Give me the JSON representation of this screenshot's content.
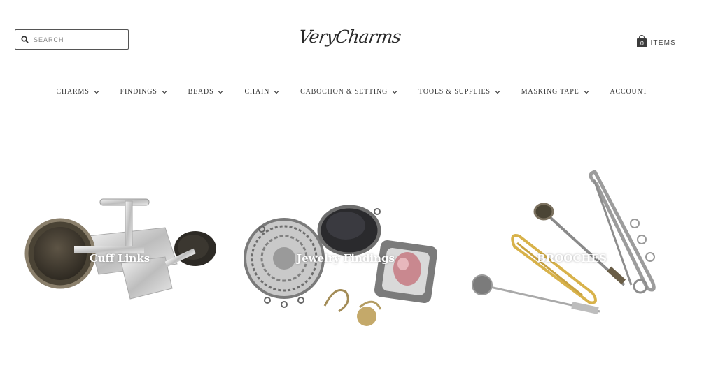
{
  "header": {
    "search": {
      "placeholder": "SEARCH"
    },
    "logo": {
      "text": "VeryCharms"
    },
    "cart": {
      "count": "0",
      "label": "ITEMS"
    }
  },
  "nav": {
    "items": [
      {
        "label": "CHARMS",
        "dropdown": true
      },
      {
        "label": "FINDINGS",
        "dropdown": true
      },
      {
        "label": "BEADS",
        "dropdown": true
      },
      {
        "label": "CHAIN",
        "dropdown": true
      },
      {
        "label": "CABOCHON & SETTING",
        "dropdown": true
      },
      {
        "label": "TOOLS & SUPPLIES",
        "dropdown": true
      },
      {
        "label": "MASKING TAPE",
        "dropdown": true
      },
      {
        "label": "ACCOUNT",
        "dropdown": false
      }
    ]
  },
  "collections": [
    {
      "title": "Cuff Links"
    },
    {
      "title": "Jewelry Findings"
    },
    {
      "title": "BROOCHES"
    }
  ],
  "colors": {
    "text": "#333333",
    "accent": "#3b3b3b",
    "divider": "#e4e4e4"
  }
}
